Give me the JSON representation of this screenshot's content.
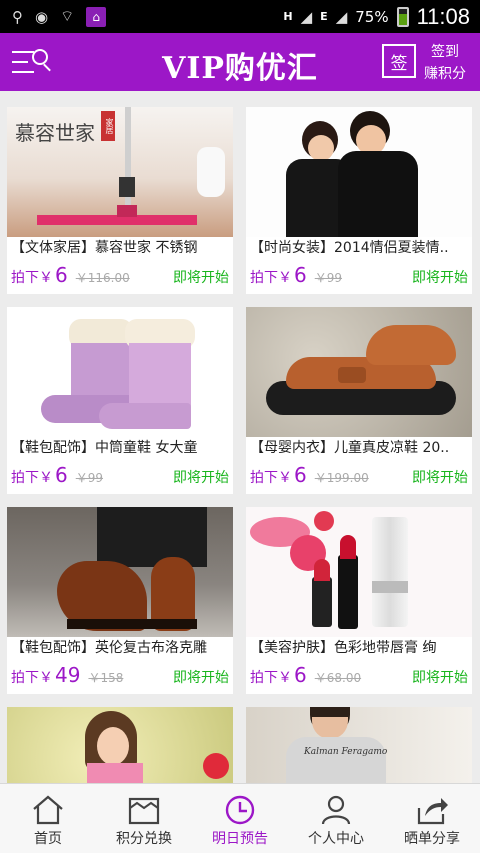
{
  "status_bar": {
    "battery": "75%",
    "time": "11:08",
    "net1": "H",
    "net2": "E"
  },
  "header": {
    "title": "VIP购优汇",
    "sign_icon_text": "签",
    "sign_line1": "签到",
    "sign_line2": "赚积分"
  },
  "products": [
    {
      "name": "【文体家居】慕容世家 不锈钢",
      "price_label": "拍下￥",
      "price": "6",
      "original": "￥116.00",
      "status": "即将开始",
      "brand_text": "慕容世家",
      "brand_tag": "家居"
    },
    {
      "name": "【时尚女装】2014情侣夏装情..",
      "price_label": "拍下￥",
      "price": "6",
      "original": "￥99",
      "status": "即将开始"
    },
    {
      "name": "【鞋包配饰】中筒童鞋 女大童",
      "price_label": "拍下￥",
      "price": "6",
      "original": "￥99",
      "status": "即将开始"
    },
    {
      "name": "【母婴内衣】儿童真皮凉鞋 20..",
      "price_label": "拍下￥",
      "price": "6",
      "original": "￥199.00",
      "status": "即将开始"
    },
    {
      "name": "【鞋包配饰】英伦复古布洛克雕",
      "price_label": "拍下￥",
      "price": "49",
      "original": "￥158",
      "status": "即将开始"
    },
    {
      "name": "【美容护肤】色彩地带唇膏 绚",
      "price_label": "拍下￥",
      "price": "6",
      "original": "￥68.00",
      "status": "即将开始"
    },
    {
      "name": ""
    },
    {
      "name": "",
      "shirt_text": "Kalman Feragamo"
    }
  ],
  "tabs": [
    {
      "label": "首页",
      "icon": "home-icon"
    },
    {
      "label": "积分兑换",
      "icon": "gift-box-icon"
    },
    {
      "label": "明日预告",
      "icon": "clock-icon",
      "active": true
    },
    {
      "label": "个人中心",
      "icon": "person-icon"
    },
    {
      "label": "晒单分享",
      "icon": "share-icon"
    }
  ],
  "colors": {
    "brand": "#9c17c7",
    "status_green": "#19b51d",
    "strike": "#aaaaaa"
  }
}
